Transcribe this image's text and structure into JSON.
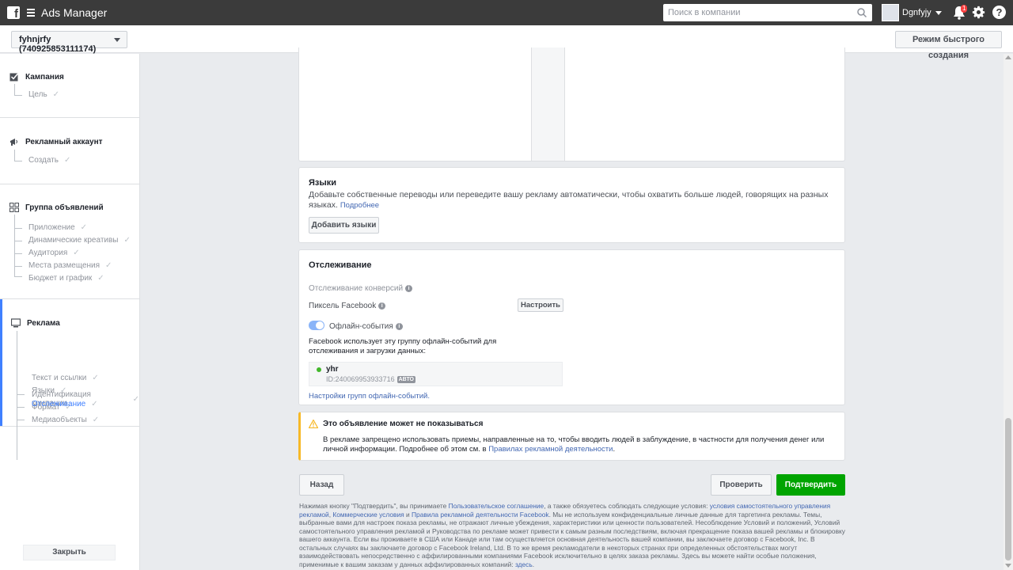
{
  "topbar": {
    "app_title": "Ads Manager",
    "search_placeholder": "Поиск в компании",
    "user_name": "Dgnfyjy",
    "notification_count": "1",
    "help_label": "?"
  },
  "subbar": {
    "account": "fyhnjrfy (740925853111174)",
    "quick_create": "Режим быстрого создания"
  },
  "sidebar": {
    "campaign": {
      "title": "Кампания",
      "items": [
        "Цель"
      ]
    },
    "ad_account": {
      "title": "Рекламный аккаунт",
      "items": [
        "Создать"
      ]
    },
    "ad_set": {
      "title": "Группа объявлений",
      "items": [
        "Приложение",
        "Динамические креативы",
        "Аудитория",
        "Места размещения",
        "Бюджет и график"
      ]
    },
    "ad": {
      "title": "Реклама",
      "items": [
        "Идентификация компании",
        "Формат",
        "Медиаобъекты",
        "Текст и ссылки",
        "Языки",
        "Отслеживание"
      ],
      "active_index": 5
    },
    "close": "Закрыть"
  },
  "languages": {
    "title": "Языки",
    "description": "Добавьте собственные переводы или переведите вашу рекламу автоматически, чтобы охватить больше людей, говорящих на разных языках.",
    "more_link": "Подробнее",
    "add_button": "Добавить языки"
  },
  "tracking": {
    "title": "Отслеживание",
    "conversion_label": "Отслеживание конверсий",
    "pixel_label": "Пиксель Facebook",
    "setup_button": "Настроить",
    "offline_label": "Офлайн-события",
    "offline_enabled": true,
    "offline_description": "Facebook использует эту группу офлайн-событий для отслеживания и загрузки данных:",
    "event_set_name": "yhr",
    "event_set_id": "ID:240069953933716",
    "auto_badge": "АВТО",
    "settings_link": "Настройки групп офлайн-событий."
  },
  "warning": {
    "title": "Это объявление может не показываться",
    "text": "В рекламе запрещено использовать приемы, направленные на то, чтобы вводить людей в заблуждение, в частности для получения денег или личной информации. Подробнее об этом см. в ",
    "link": "Правилах рекламной деятельности",
    "text_end": "."
  },
  "actions": {
    "back": "Назад",
    "review": "Проверить",
    "confirm": "Подтвердить"
  },
  "footer": {
    "p1": "Нажимая кнопку \"Подтвердить\", вы принимаете ",
    "l1": "Пользовательское соглашение",
    "p2": ", а также обязуетесь соблюдать следующие условия: ",
    "l2": "условия самостоятельного управления рекламой",
    "p3": ", ",
    "l3": "Коммерческие условия",
    "p4": " и ",
    "l4": "Правила рекламной деятельности Facebook",
    "p5": ". Мы не используем конфиденциальные личные данные для таргетинга рекламы. Темы, выбранные вами для настроек показа рекламы, не отражают личные убеждения, характеристики или ценности пользователей. Несоблюдение Условий и положений, Условий самостоятельного управления рекламой и Руководства по рекламе может привести к самым разным последствиям, включая прекращение показа вашей рекламы и блокировку вашего аккаунта. Если вы проживаете в США или Канаде или там осуществляется основная деятельность вашей компании, вы заключаете договор с Facebook, Inc. В остальных случаях вы заключаете договор с Facebook Ireland, Ltd. В то же время рекламодатели в некоторых странах при определенных обстоятельствах могут взаимодействовать непосредственно с аффилированными компаниями Facebook исключительно в целях заказа рекламы. Здесь вы можете найти особые положения, применимые к вашим заказам у данных аффилированных компаний: ",
    "l5": "здесь",
    "p6": "."
  },
  "colors": {
    "topbar": "#3b3b3b",
    "accent": "#4080ff",
    "confirm_green": "#42b72a",
    "warning_yellow": "#f7b928",
    "link": "#4267b2"
  }
}
